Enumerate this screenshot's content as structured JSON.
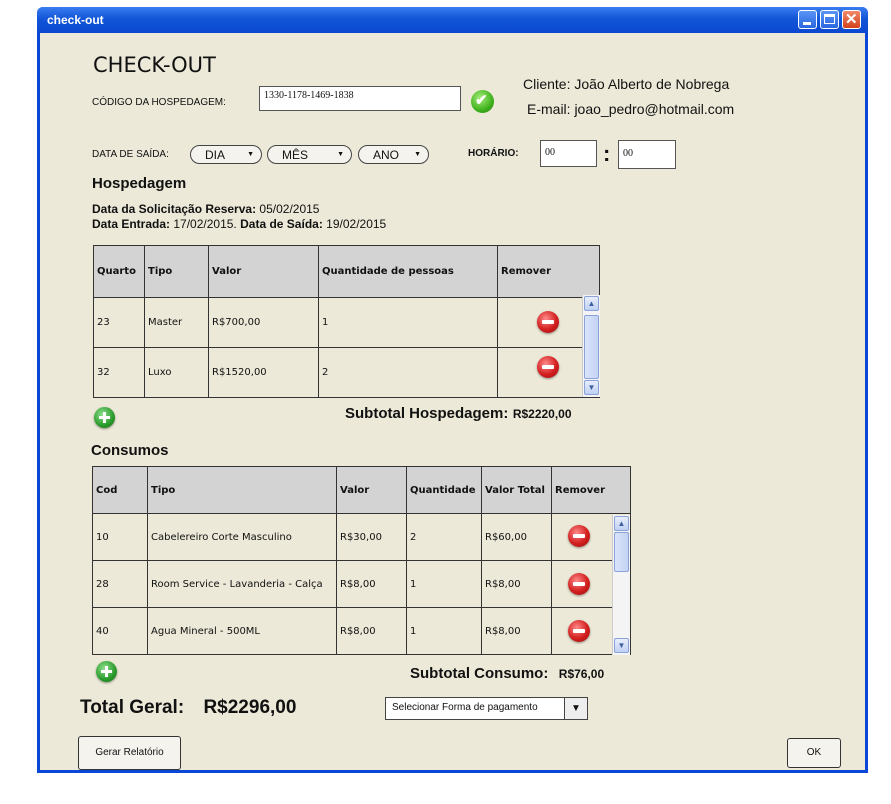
{
  "window": {
    "title": "check-out"
  },
  "header": {
    "title": "CHECK-OUT",
    "codigo_label": "CÓDIGO DA HOSPEDAGEM:",
    "codigo_value": "1330-1178-1469-1838",
    "cliente": "Cliente: João Alberto de Nobrega",
    "email": "E-mail: joao_pedro@hotmail.com"
  },
  "saida": {
    "label": "DATA DE SAÍDA:",
    "dia": "DIA",
    "mes": "MÊS",
    "ano": "ANO",
    "horario_label": "HORÁRIO:",
    "hora": "00",
    "sep": ":",
    "minuto": "00"
  },
  "hospedagem": {
    "title": "Hospedagem",
    "solicitacao_label": "Data da Solicitação Reserva:",
    "solicitacao_value": "05/02/2015",
    "entrada_label": "Data Entrada:",
    "entrada_value": "17/02/2015.",
    "saida_label": "Data de Saída:",
    "saida_value": "19/02/2015",
    "columns": [
      "Quarto",
      "Tipo",
      "Valor",
      "Quantidade de pessoas",
      "Remover"
    ],
    "rows": [
      {
        "quarto": "23",
        "tipo": "Master",
        "valor": "R$700,00",
        "qtd": "1"
      },
      {
        "quarto": "32",
        "tipo": "Luxo",
        "valor": "R$1520,00",
        "qtd": "2"
      }
    ],
    "subtotal_label": "Subtotal Hospedagem:",
    "subtotal_value": "R$2220,00"
  },
  "consumos": {
    "title": "Consumos",
    "columns": [
      "Cod",
      "Tipo",
      "Valor",
      "Quantidade",
      "Valor Total",
      "Remover"
    ],
    "rows": [
      {
        "cod": "10",
        "tipo": "Cabelereiro Corte Masculino",
        "valor": "R$30,00",
        "qtd": "2",
        "total": "R$60,00"
      },
      {
        "cod": "28",
        "tipo": "Room Service - Lavanderia - Calça",
        "valor": "R$8,00",
        "qtd": "1",
        "total": "R$8,00"
      },
      {
        "cod": "40",
        "tipo": "Agua Mineral - 500ML",
        "valor": "R$8,00",
        "qtd": "1",
        "total": "R$8,00"
      }
    ],
    "subtotal_label": "Subtotal Consumo:",
    "subtotal_value": "R$76,00"
  },
  "footer": {
    "total_label": "Total Geral:",
    "total_value": "R$2296,00",
    "pagamento": "Selecionar Forma de pagamento",
    "relatorio": "Gerar Relatório",
    "ok": "OK"
  },
  "colors": {
    "titlebar": "#0a47d6",
    "client_bg": "#ece9d8",
    "remove": "#d31f1f",
    "add": "#2a9a2a"
  }
}
